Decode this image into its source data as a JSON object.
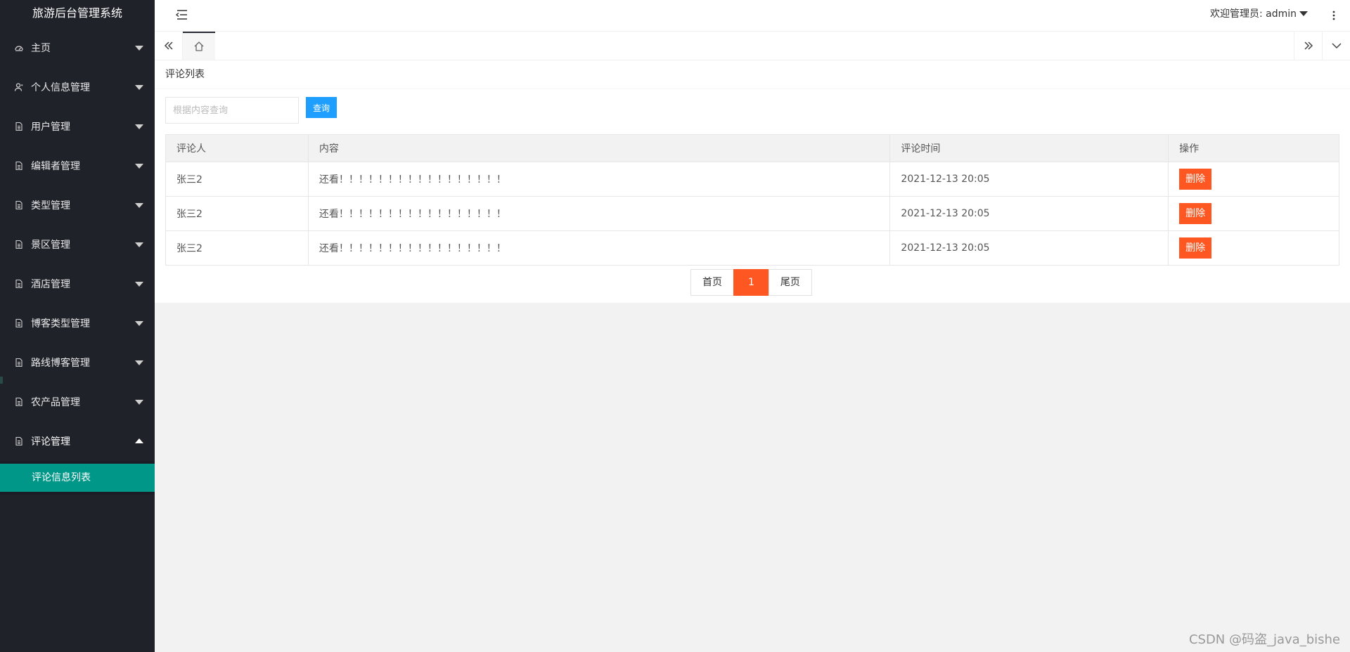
{
  "app_title": "旅游后台管理系统",
  "sidebar": {
    "items": [
      {
        "label": "主页",
        "icon": "dashboard-icon"
      },
      {
        "label": "个人信息管理",
        "icon": "user-icon"
      },
      {
        "label": "用户管理",
        "icon": "file-icon"
      },
      {
        "label": "编辑者管理",
        "icon": "file-icon"
      },
      {
        "label": "类型管理",
        "icon": "file-icon"
      },
      {
        "label": "景区管理",
        "icon": "file-icon"
      },
      {
        "label": "酒店管理",
        "icon": "file-icon"
      },
      {
        "label": "博客类型管理",
        "icon": "file-icon"
      },
      {
        "label": "路线博客管理",
        "icon": "file-icon"
      },
      {
        "label": "农产品管理",
        "icon": "file-icon"
      },
      {
        "label": "评论管理",
        "icon": "file-icon",
        "expanded": true
      }
    ],
    "sub_items": [
      {
        "label": "评论信息列表",
        "active": true
      }
    ]
  },
  "header": {
    "user_text": "欢迎管理员: admin"
  },
  "tabs": {
    "home_icon": "home-icon"
  },
  "panel": {
    "title": "评论列表",
    "search_placeholder": "根据内容查询",
    "search_button": "查询"
  },
  "table": {
    "columns": [
      "评论人",
      "内容",
      "评论时间",
      "操作"
    ],
    "rows": [
      {
        "author": "张三2",
        "content": "还看！！！！！！！！！！！！！！！！！",
        "time": "2021-12-13 20:05",
        "action": "删除"
      },
      {
        "author": "张三2",
        "content": "还看！！！！！！！！！！！！！！！！！",
        "time": "2021-12-13 20:05",
        "action": "删除"
      },
      {
        "author": "张三2",
        "content": "还看！！！！！！！！！！！！！！！！！",
        "time": "2021-12-13 20:05",
        "action": "删除"
      }
    ]
  },
  "pager": {
    "first": "首页",
    "current": "1",
    "last": "尾页"
  },
  "watermark": "CSDN @码盗_java_bishe",
  "colors": {
    "sidebar_bg": "#20222a",
    "active_sub": "#009688",
    "primary_btn": "#1e9fff",
    "danger_btn": "#ff5722"
  }
}
